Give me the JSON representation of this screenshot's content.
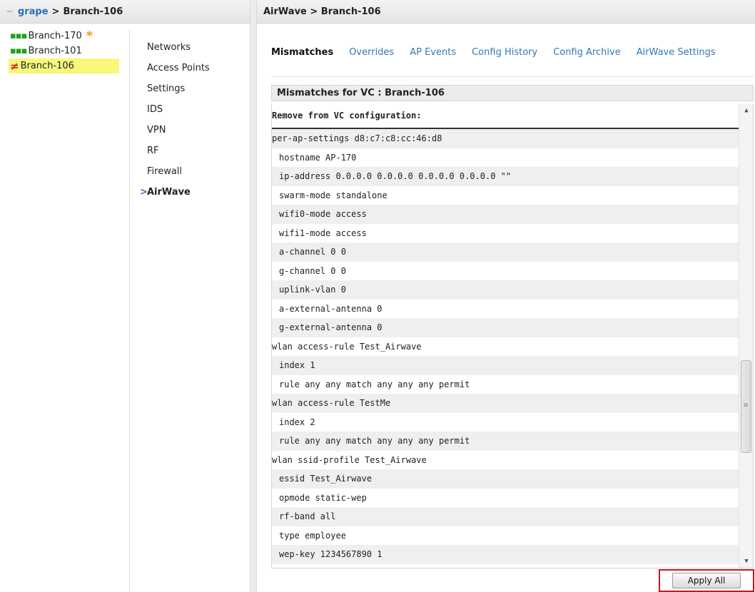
{
  "left_header": {
    "collapse_icon": "−",
    "root_link": "grape",
    "separator": ">",
    "current": "Branch-106"
  },
  "tree": [
    {
      "label": "Branch-170",
      "status": "ok",
      "badge": "*"
    },
    {
      "label": "Branch-101",
      "status": "ok",
      "badge": ""
    },
    {
      "label": "Branch-106",
      "status": "mismatch",
      "badge": ""
    }
  ],
  "status_glyphs": {
    "ok": "▪▪▪",
    "mismatch": "≠"
  },
  "nav": [
    "Networks",
    "Access Points",
    "Settings",
    "IDS",
    "VPN",
    "RF",
    "Firewall",
    "AirWave"
  ],
  "nav_active_arrow": ">",
  "right_header": {
    "title": "AirWave > Branch-106"
  },
  "tabs": [
    "Mismatches",
    "Overrides",
    "AP Events",
    "Config History",
    "Config Archive",
    "AirWave Settings"
  ],
  "section_title": "Mismatches for VC : Branch-106",
  "code_heading": "Remove from VC configuration:",
  "code_lines": [
    {
      "text": "per-ap-settings d8:c7:c8:cc:46:d8",
      "indent": false
    },
    {
      "text": "hostname AP-170",
      "indent": true
    },
    {
      "text": "ip-address 0.0.0.0 0.0.0.0 0.0.0.0 0.0.0.0 \"\"",
      "indent": true
    },
    {
      "text": "swarm-mode standalone",
      "indent": true
    },
    {
      "text": "wifi0-mode access",
      "indent": true
    },
    {
      "text": "wifi1-mode access",
      "indent": true
    },
    {
      "text": "a-channel 0 0",
      "indent": true
    },
    {
      "text": "g-channel 0 0",
      "indent": true
    },
    {
      "text": "uplink-vlan 0",
      "indent": true
    },
    {
      "text": "a-external-antenna 0",
      "indent": true
    },
    {
      "text": "g-external-antenna 0",
      "indent": true
    },
    {
      "text": "wlan access-rule Test_Airwave",
      "indent": false
    },
    {
      "text": "index 1",
      "indent": true
    },
    {
      "text": "rule any any match any any any permit",
      "indent": true
    },
    {
      "text": "wlan access-rule TestMe",
      "indent": false
    },
    {
      "text": "index 2",
      "indent": true
    },
    {
      "text": "rule any any match any any any permit",
      "indent": true
    },
    {
      "text": "wlan ssid-profile Test_Airwave",
      "indent": false
    },
    {
      "text": "essid Test_Airwave",
      "indent": true
    },
    {
      "text": "opmode static-wep",
      "indent": true
    },
    {
      "text": "rf-band all",
      "indent": true
    },
    {
      "text": "type employee",
      "indent": true
    },
    {
      "text": "wep-key 1234567890 1",
      "indent": true
    }
  ],
  "apply_all_label": "Apply All",
  "colors": {
    "link": "#2f7ab8",
    "ok": "#1ba31b",
    "mismatch": "#d41c1c",
    "badge": "#f39a1a",
    "selected_bg": "#f7f77a",
    "highlight_border": "#c8151b"
  }
}
